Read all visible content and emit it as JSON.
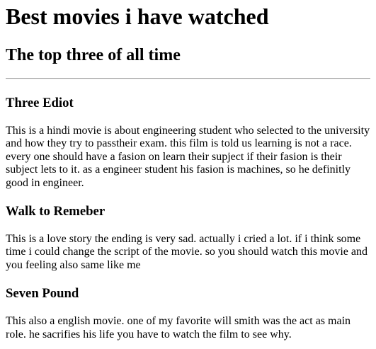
{
  "page": {
    "title": "Best movies i have watched",
    "subtitle": "The top three of all time"
  },
  "movies": [
    {
      "title": "Three Ediot",
      "description": "This is a hindi movie is about engineering student who selected to the university and how they try to passtheir exam. this film is told us learning is not a race. every one should have a fasion on learn their supject if their fasion is their subject lets to it. as a engineer student his fasion is machines, so he definitly good in engineer."
    },
    {
      "title": "Walk to Remeber",
      "description": "This is a love story the ending is very sad. actually i cried a lot. if i think some time i could change the script of the movie. so you should watch this movie and you feeling also same like me"
    },
    {
      "title": "Seven Pound",
      "description": "This also a english movie. one of my favorite will smith was the act as main role. he sacrifies his life you have to watch the film to see why."
    }
  ]
}
